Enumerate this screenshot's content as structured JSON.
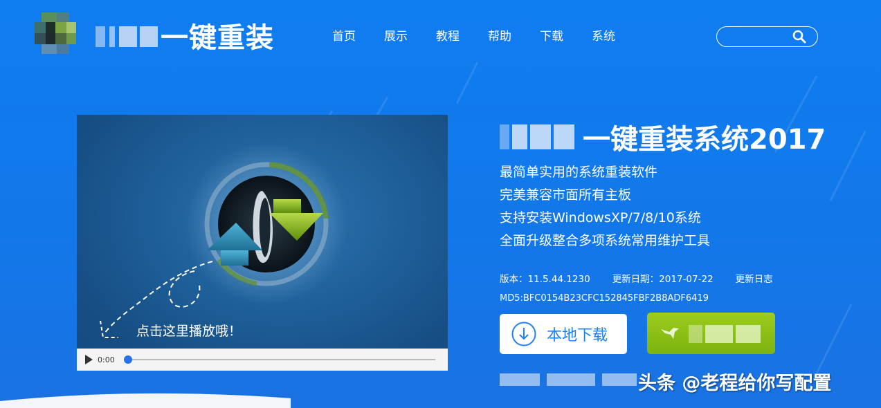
{
  "header": {
    "logo_text": "一键重装",
    "nav": [
      "首页",
      "展示",
      "教程",
      "帮助",
      "下载",
      "系统"
    ],
    "search": {
      "placeholder": "",
      "value": ""
    }
  },
  "video": {
    "caption": "点击这里播放哦！",
    "time": "0:00",
    "progress": 0
  },
  "product": {
    "title": "一键重装系统2017",
    "features": [
      "最简单实用的系统重装软件",
      "完美兼容市面所有主板",
      "支持安装WindowsXP/7/8/10系统",
      "全面升级整合多项系统常用维护工具"
    ],
    "version": "版本：11.5.44.1230",
    "update_date": "更新日期：2017-07-22",
    "changelog": "更新日志",
    "md5": "MD5:BFC0154B23CFC152845FBF2B8ADF6419",
    "local_download_label": "本地下载"
  },
  "watermark": "头条 @老程给你写配置",
  "colors": {
    "background": "#1278ea",
    "accent_blue": "#1f80f0",
    "green_button": "#8dc117"
  }
}
